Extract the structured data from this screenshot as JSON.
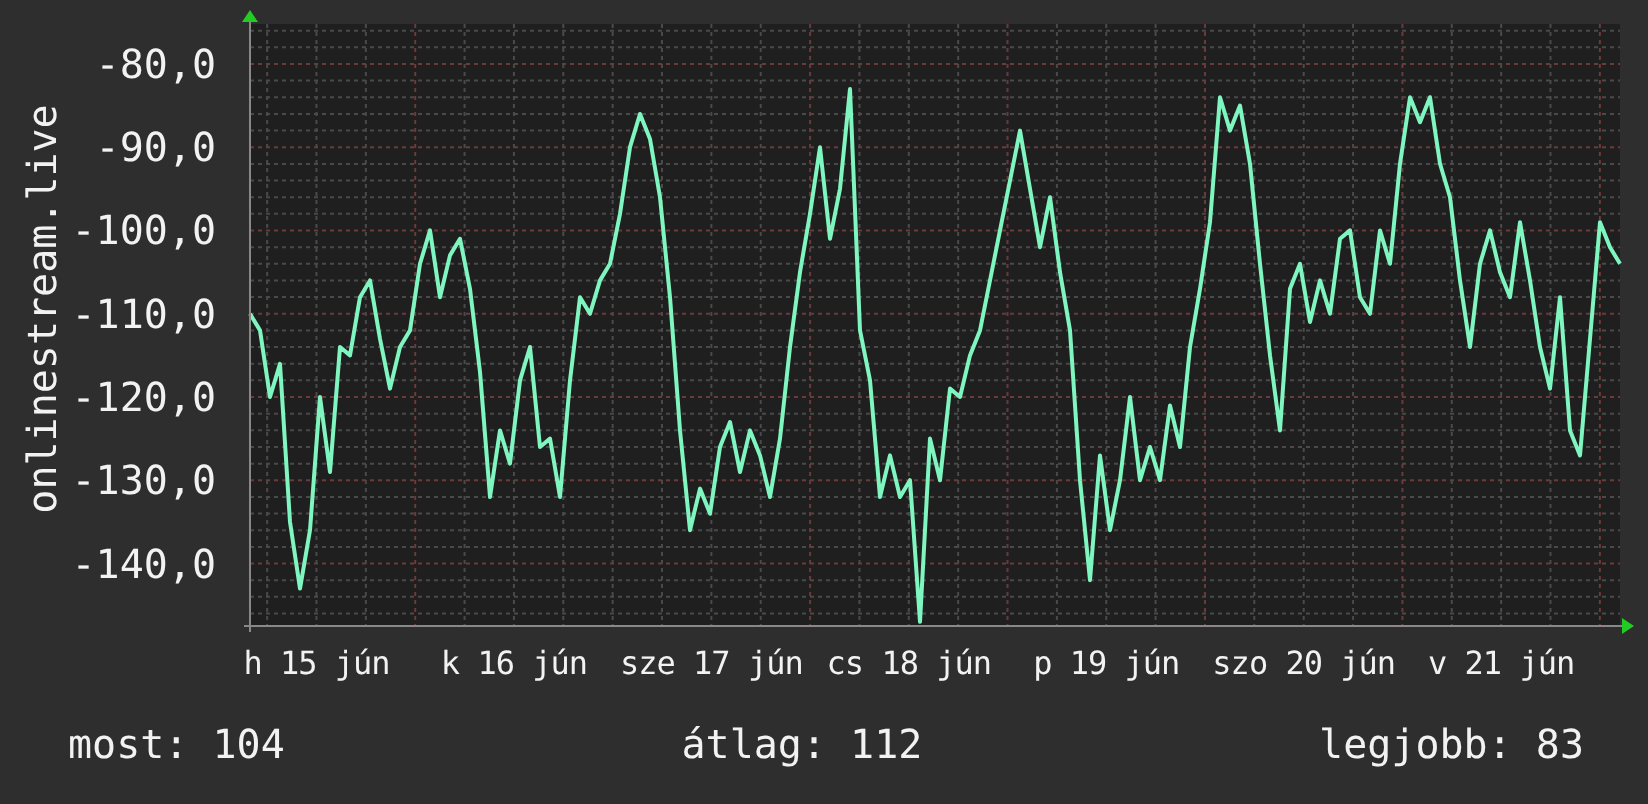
{
  "graph": {
    "x_labels": [
      "h 15 jún",
      "k 16 jún",
      "sze 17 jún",
      "cs 18 jún",
      "p 19 jún",
      "szo 20 jún",
      "v 21 jún"
    ],
    "chart_data": {
      "type": "line",
      "grid": true,
      "ylim": [
        -147.5,
        -75.2
      ],
      "yticks": [
        {
          "value": -80,
          "label": "-80,0"
        },
        {
          "value": -90,
          "label": "-90,0"
        },
        {
          "value": -100,
          "label": "-100,0"
        },
        {
          "value": -110,
          "label": "-110,0"
        },
        {
          "value": -120,
          "label": "-120,0"
        },
        {
          "value": -130,
          "label": "-130,0"
        },
        {
          "value": -140,
          "label": "-140,0"
        }
      ],
      "series": [
        {
          "name": "onlinestream.live",
          "color": "#7ff5c0",
          "values": [
            -110,
            -112,
            -120,
            -116,
            -135,
            -143,
            -136,
            -120,
            -129,
            -114,
            -115,
            -108,
            -106,
            -113,
            -119,
            -114,
            -112,
            -104,
            -100,
            -108,
            -103,
            -101,
            -107,
            -117,
            -132,
            -124,
            -128,
            -118,
            -114,
            -126,
            -125,
            -132,
            -118,
            -108,
            -110,
            -106,
            -104,
            -98,
            -90,
            -86,
            -89,
            -96,
            -108,
            -124,
            -136,
            -131,
            -134,
            -126,
            -123,
            -129,
            -124,
            -127,
            -132,
            -125,
            -114,
            -105,
            -98,
            -90,
            -101,
            -95,
            -83,
            -112,
            -118,
            -132,
            -127,
            -132,
            -130,
            -147,
            -125,
            -130,
            -119,
            -120,
            -115,
            -112,
            -106,
            -100,
            -94,
            -88,
            -95,
            -102,
            -96,
            -105,
            -112,
            -130,
            -142,
            -127,
            -136,
            -130,
            -120,
            -130,
            -126,
            -130,
            -121,
            -126,
            -114,
            -107,
            -99,
            -84,
            -88,
            -85,
            -92,
            -104,
            -115,
            -124,
            -107,
            -104,
            -111,
            -106,
            -110,
            -101,
            -100,
            -108,
            -110,
            -100,
            -104,
            -92,
            -84,
            -87,
            -84,
            -92,
            -96,
            -106,
            -114,
            -104,
            -100,
            -105,
            -108,
            -99,
            -106,
            -114,
            -119,
            -108,
            -124,
            -127,
            -113,
            -99,
            -102,
            -104
          ]
        }
      ]
    }
  },
  "legend": [
    "most: 104",
    "átlag: 112",
    "legjobb: 83"
  ]
}
